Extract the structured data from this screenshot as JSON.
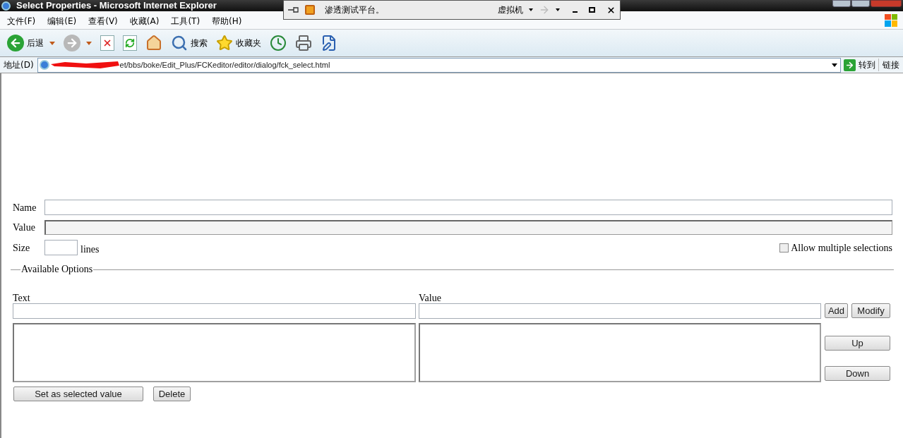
{
  "window": {
    "title": "Select Properties - Microsoft Internet Explorer"
  },
  "vm_toolbar": {
    "title": "渗透测试平台。",
    "menu": "虚拟机"
  },
  "menu": [
    "文件(F)",
    "编辑(E)",
    "查看(V)",
    "收藏(A)",
    "工具(T)",
    "帮助(H)"
  ],
  "toolbar": [
    {
      "kind": "back",
      "label": "后退"
    },
    {
      "kind": "forward"
    },
    {
      "kind": "stop"
    },
    {
      "kind": "refresh"
    },
    {
      "kind": "home"
    },
    {
      "kind": "search",
      "label": "搜索"
    },
    {
      "kind": "favorites",
      "label": "收藏夹"
    },
    {
      "kind": "history"
    },
    {
      "kind": "print"
    },
    {
      "kind": "edit"
    }
  ],
  "address": {
    "label": "地址(D)",
    "value": "et/bbs/boke/Edit_Plus/FCKeditor/editor/dialog/fck_select.html",
    "go": "转到",
    "links": "链接"
  },
  "form": {
    "name_label": "Name",
    "value_label": "Value",
    "value_disabled": true,
    "size_label": "Size",
    "size_unit": "lines",
    "multiple": {
      "label": "Allow multiple selections",
      "checked": false
    }
  },
  "options": {
    "legend": "Available Options",
    "text_label": "Text",
    "value_label": "Value",
    "add": "Add",
    "modify": "Modify",
    "up": "Up",
    "down": "Down",
    "set_selected": "Set as selected value",
    "delete": "Delete"
  }
}
